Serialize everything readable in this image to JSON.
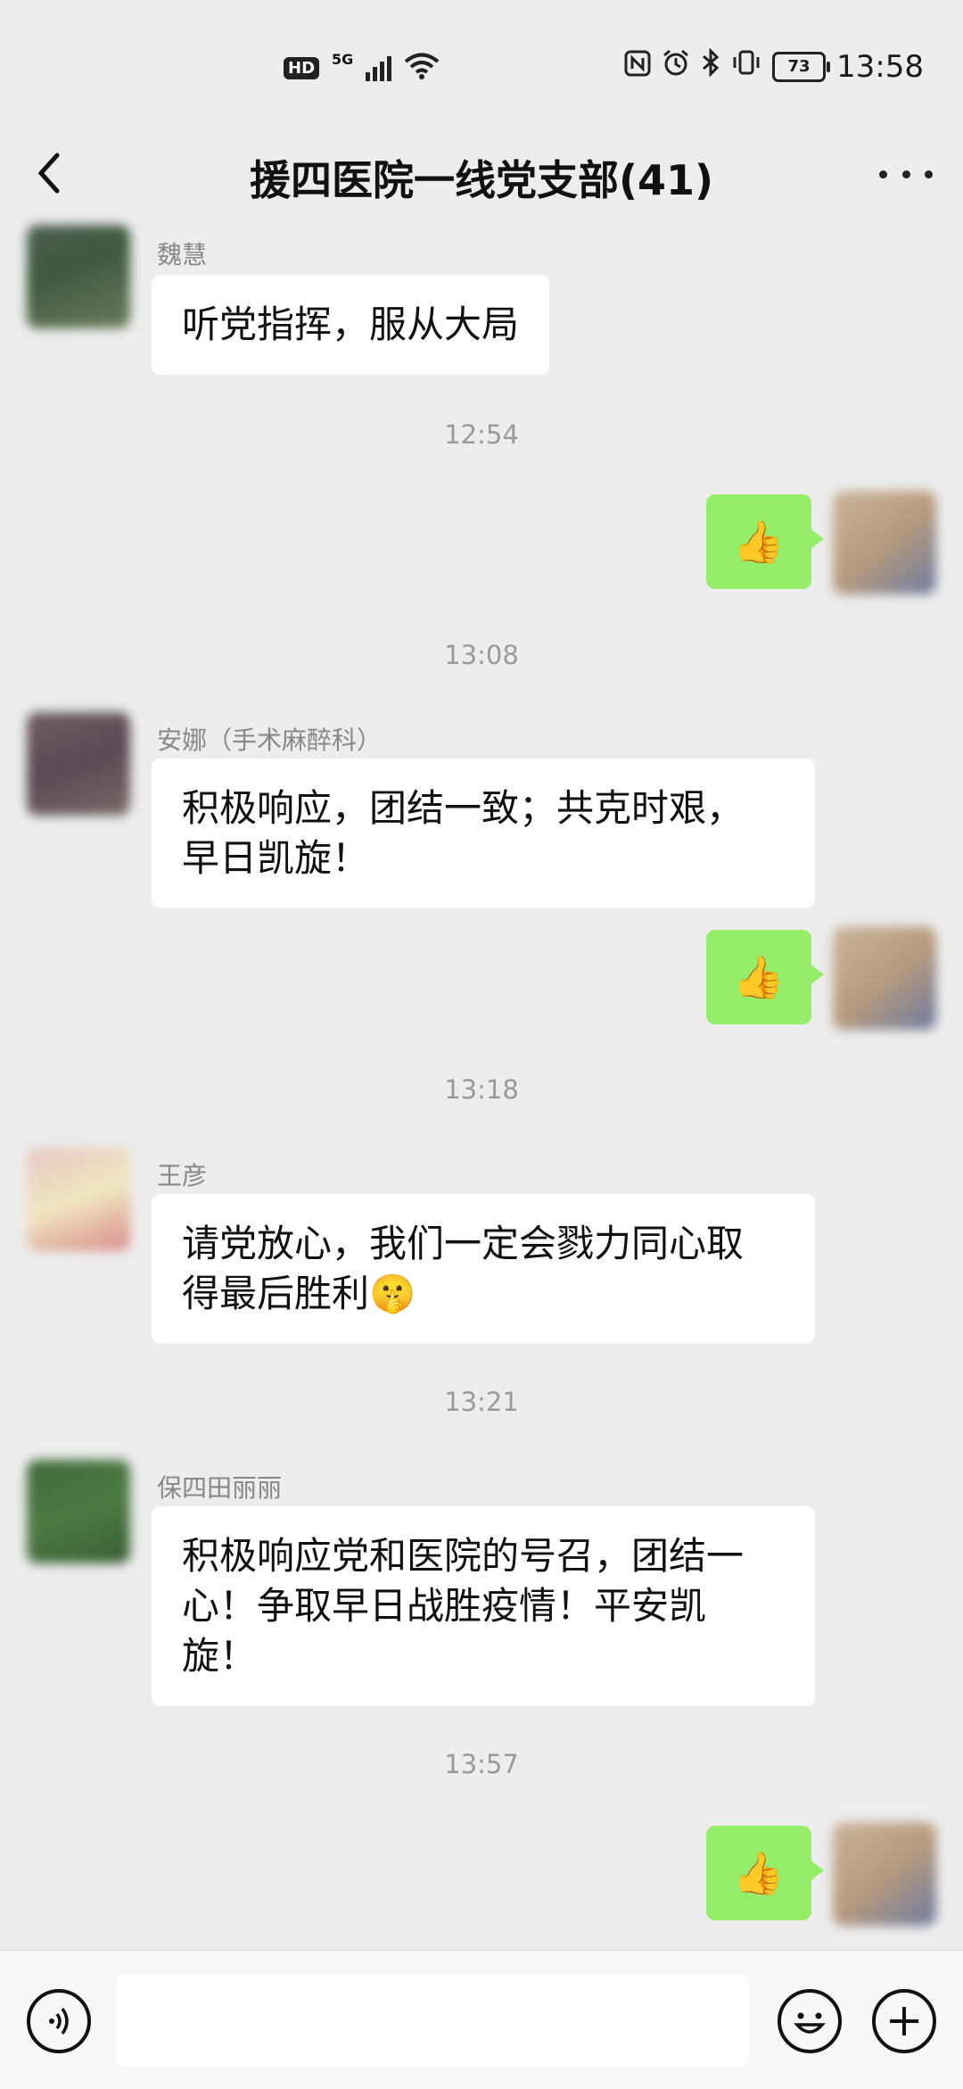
{
  "status_bar": {
    "network_badge": "HD",
    "network_type": "5G",
    "battery": "73",
    "time": "13:58"
  },
  "header": {
    "title": "援四医院一线党支部(41)",
    "back_icon": "chevron-left-icon",
    "more_icon": "more-dots-icon"
  },
  "messages": [
    {
      "sender": "魏慧",
      "text": "听党指挥，服从大局"
    },
    {
      "time": "12:54"
    },
    {
      "self_emoji": "👍"
    },
    {
      "time": "13:08"
    },
    {
      "sender": "安娜（手术麻醉科）",
      "text_lines": [
        "积极响应，团结一致；共克时艰，",
        "早日凯旋！"
      ]
    },
    {
      "self_emoji": "👍"
    },
    {
      "time": "13:18"
    },
    {
      "sender": "王彦",
      "text_lines": [
        "请党放心，我们一定会戮力同心取",
        "得最后胜利🤫"
      ]
    },
    {
      "time": "13:21"
    },
    {
      "sender": "保四田丽丽",
      "text_lines": [
        "积极响应党和医院的号召，团结一",
        "心！争取早日战胜疫情！平安凯",
        "旋！"
      ]
    },
    {
      "time": "13:57"
    },
    {
      "self_emoji": "👍"
    }
  ],
  "input_bar": {
    "voice_icon": "voice-icon",
    "emoji_icon": "emoji-icon",
    "plus_icon": "plus-icon"
  },
  "colors": {
    "background": "#ededed",
    "self_bubble": "#95ec69",
    "other_bubble": "#ffffff"
  }
}
